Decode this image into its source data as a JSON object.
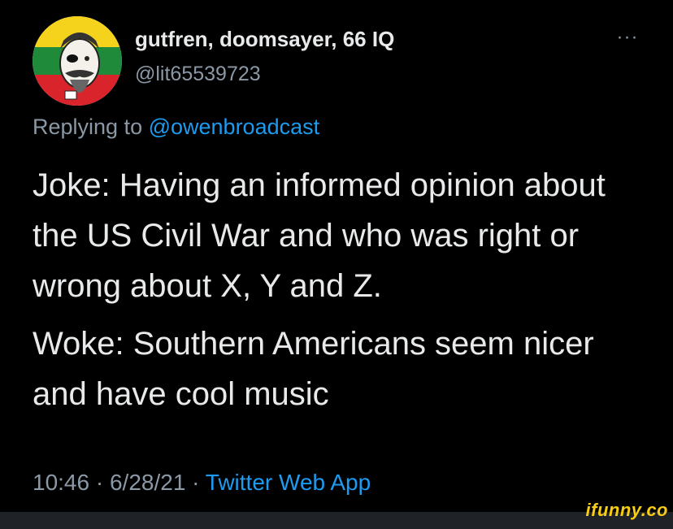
{
  "tweet": {
    "display_name": "gutfren, doomsayer, 66 IQ",
    "handle": "@lit65539723",
    "more_icon": "more-horizontal-icon",
    "replying_prefix": "Replying to ",
    "replying_to": "@owenbroadcast",
    "paragraphs": [
      "Joke: Having an informed opinion about the US Civil War and who was right or wrong about X, Y and Z.",
      "Woke: Southern Americans seem nicer and have cool music"
    ],
    "time": "10:46",
    "separator": " · ",
    "date": "6/28/21",
    "app": "Twitter Web App"
  },
  "colors": {
    "background": "#000000",
    "text": "#e7e9ea",
    "muted": "#8b98a5",
    "link": "#1d9bf0",
    "watermark": "#f7cc14"
  },
  "watermark": "ifunny.co"
}
